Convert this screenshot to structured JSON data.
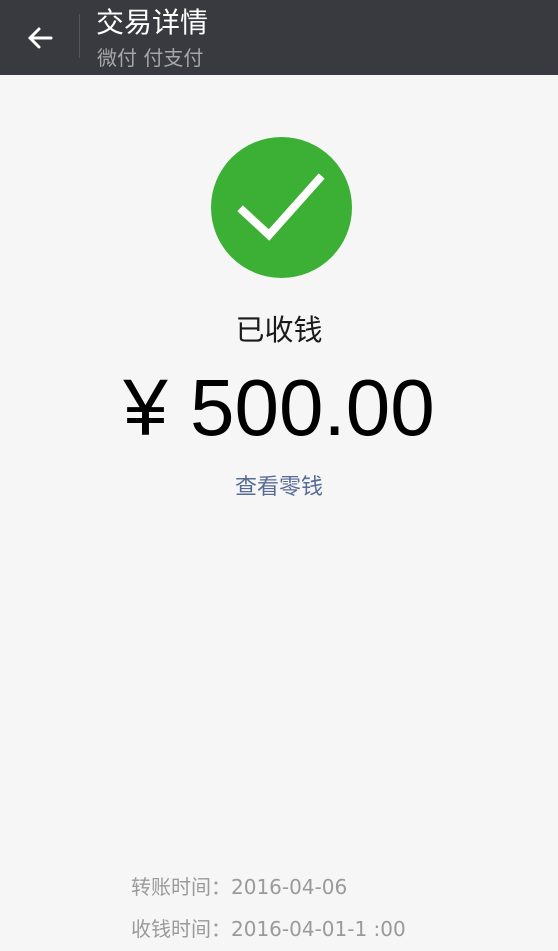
{
  "header": {
    "title": "交易详情",
    "subtitle": "微付 付支付",
    "back_icon": "arrow-left-icon"
  },
  "status": {
    "icon": "checkmark-icon",
    "color": "#3cb035",
    "text": "已收钱"
  },
  "amount": "¥ 500.00",
  "link": {
    "label": "查看零钱",
    "color": "#576b95"
  },
  "details": [
    {
      "label": "转账时间：",
      "value": "2016-04-06 "
    },
    {
      "label": "收钱时间：",
      "value": "2016-04-01-1 :00"
    }
  ]
}
